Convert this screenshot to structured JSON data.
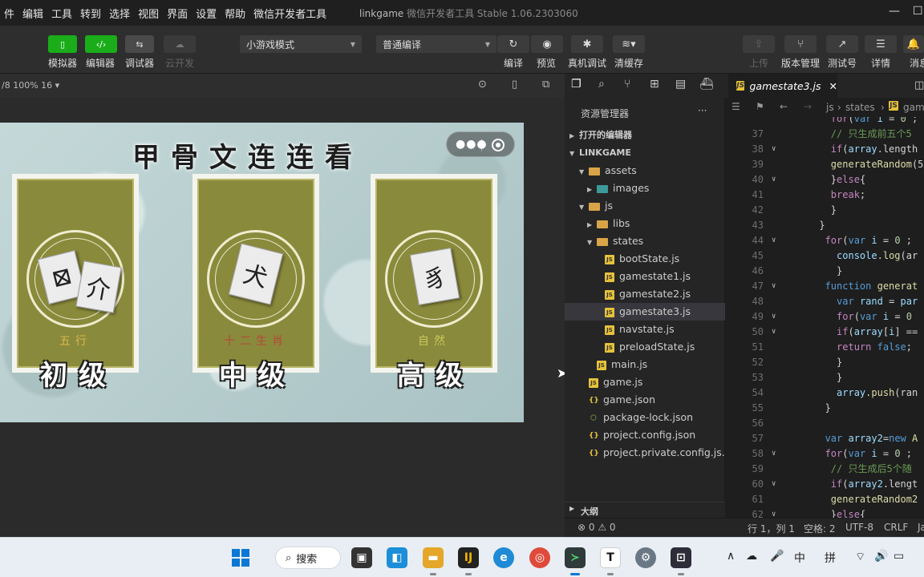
{
  "menu": [
    "件",
    "编辑",
    "工具",
    "转到",
    "选择",
    "视图",
    "界面",
    "设置",
    "帮助",
    "微信开发者工具"
  ],
  "window_title": {
    "project": "linkgame",
    "app": "微信开发者工具 Stable 1.06.2303060"
  },
  "toolbar": {
    "left_buttons": [
      {
        "label": "模拟器",
        "color": "#1aad19"
      },
      {
        "label": "编辑器",
        "color": "#1aad19"
      },
      {
        "label": "调试器",
        "color": "#4a4a4a"
      },
      {
        "label": "云开发",
        "color": "#3a3a3a"
      }
    ],
    "mode_select": "小游戏模式",
    "compile_select": "普通编译",
    "center_buttons": [
      {
        "label": "编译"
      },
      {
        "label": "预览"
      },
      {
        "label": "真机调试"
      },
      {
        "label": "清缓存"
      }
    ],
    "right_buttons": [
      {
        "label": "上传"
      },
      {
        "label": "版本管理"
      },
      {
        "label": "测试号"
      },
      {
        "label": "详情"
      },
      {
        "label": "消息"
      }
    ]
  },
  "simulator": {
    "header": "/8 100% 16 ▾",
    "game_title": "甲骨文连连看",
    "cards": [
      {
        "level": "初级",
        "subtitle": "五行",
        "subtitle_color": "#d9b94a",
        "glyphs": [
          "⊠",
          "介"
        ]
      },
      {
        "level": "中级",
        "subtitle": "十二生肖",
        "subtitle_color": "#b24a3a",
        "glyphs": [
          "犬"
        ]
      },
      {
        "level": "高级",
        "subtitle": "自然",
        "subtitle_color": "#c8c85a",
        "glyphs": [
          "豸"
        ]
      }
    ]
  },
  "explorer": {
    "title": "资源管理器",
    "more": "···",
    "sections": {
      "open_editors": "打开的编辑器",
      "project": "LINKGAME",
      "outline": "大纲"
    },
    "tree": [
      {
        "name": "assets",
        "type": "folder",
        "depth": 1,
        "open": true
      },
      {
        "name": "images",
        "type": "folder-img",
        "depth": 2,
        "open": false
      },
      {
        "name": "js",
        "type": "folder",
        "depth": 1,
        "open": true
      },
      {
        "name": "libs",
        "type": "folder",
        "depth": 2,
        "open": false
      },
      {
        "name": "states",
        "type": "folder",
        "depth": 2,
        "open": true
      },
      {
        "name": "bootState.js",
        "type": "js",
        "depth": 3
      },
      {
        "name": "gamestate1.js",
        "type": "js",
        "depth": 3
      },
      {
        "name": "gamestate2.js",
        "type": "js",
        "depth": 3
      },
      {
        "name": "gamestate3.js",
        "type": "js",
        "depth": 3,
        "selected": true
      },
      {
        "name": "navstate.js",
        "type": "js",
        "depth": 3
      },
      {
        "name": "preloadState.js",
        "type": "js",
        "depth": 3
      },
      {
        "name": "main.js",
        "type": "js",
        "depth": 2
      },
      {
        "name": "game.js",
        "type": "js",
        "depth": 1
      },
      {
        "name": "game.json",
        "type": "json",
        "depth": 1
      },
      {
        "name": "package-lock.json",
        "type": "pkg",
        "depth": 1
      },
      {
        "name": "project.config.json",
        "type": "json",
        "depth": 1
      },
      {
        "name": "project.private.config.js...",
        "type": "json",
        "depth": 1
      }
    ]
  },
  "editor": {
    "tab": "gamestate3.js",
    "breadcrumb": [
      "js",
      "states",
      "gam"
    ],
    "lines": [
      {
        "n": "",
        "fold": false,
        "html": "        <span class='kw'>for</span>(<span class='kb'>var</span> <span class='vr'>i</span> = <span class='nm'>0</span> ;"
      },
      {
        "n": "37",
        "fold": false,
        "html": "        <span class='cm'>// 只生成前五个5</span>"
      },
      {
        "n": "38",
        "fold": true,
        "html": "        <span class='kw'>if</span>(<span class='vr'>array</span>.length"
      },
      {
        "n": "39",
        "fold": false,
        "html": "        <span class='fn'>generateRandom</span>(5"
      },
      {
        "n": "40",
        "fold": true,
        "html": "        }<span class='kw'>else</span>{"
      },
      {
        "n": "41",
        "fold": false,
        "html": "        <span class='kw'>break</span>;"
      },
      {
        "n": "42",
        "fold": false,
        "html": "        }"
      },
      {
        "n": "43",
        "fold": false,
        "html": "      }"
      },
      {
        "n": "44",
        "fold": true,
        "html": "       <span class='kw'>for</span>(<span class='kb'>var</span> <span class='vr'>i</span> = <span class='nm'>0</span> ;"
      },
      {
        "n": "45",
        "fold": false,
        "html": "         <span class='vr'>console</span>.<span class='fn'>log</span>(ar"
      },
      {
        "n": "46",
        "fold": false,
        "html": "         }"
      },
      {
        "n": "47",
        "fold": true,
        "html": "       <span class='kb'>function</span> <span class='fn'>generat</span>"
      },
      {
        "n": "48",
        "fold": false,
        "html": "         <span class='kb'>var</span> <span class='vr'>rand</span> = <span class='vr'>par</span>"
      },
      {
        "n": "49",
        "fold": true,
        "html": "         <span class='kw'>for</span>(<span class='kb'>var</span> <span class='vr'>i</span> = <span class='nm'>0</span>"
      },
      {
        "n": "50",
        "fold": true,
        "html": "         <span class='kw'>if</span>(<span class='vr'>array</span>[<span class='vr'>i</span>] =="
      },
      {
        "n": "51",
        "fold": false,
        "html": "         <span class='kw'>return</span> <span class='kb'>false</span>;"
      },
      {
        "n": "52",
        "fold": false,
        "html": "         }"
      },
      {
        "n": "53",
        "fold": false,
        "html": "         }"
      },
      {
        "n": "54",
        "fold": false,
        "html": "         <span class='vr'>array</span>.<span class='fn'>push</span>(ran"
      },
      {
        "n": "55",
        "fold": false,
        "html": "       }"
      },
      {
        "n": "56",
        "fold": false,
        "html": ""
      },
      {
        "n": "57",
        "fold": false,
        "html": "       <span class='kb'>var</span> <span class='vr'>array2</span>=<span class='kb'>new</span> <span class='fn'>A</span>"
      },
      {
        "n": "58",
        "fold": true,
        "html": "       <span class='kw'>for</span>(<span class='kb'>var</span> <span class='vr'>i</span> = <span class='nm'>0</span> ;"
      },
      {
        "n": "59",
        "fold": false,
        "html": "        <span class='cm'>// 只生成后5个随</span>"
      },
      {
        "n": "60",
        "fold": true,
        "html": "        <span class='kw'>if</span>(<span class='vr'>array2</span>.lengt"
      },
      {
        "n": "61",
        "fold": false,
        "html": "        <span class='fn'>generateRandom2</span>"
      },
      {
        "n": "62",
        "fold": true,
        "html": "        }<span class='kw'>else</span>{"
      }
    ]
  },
  "status": {
    "problems": "⊗ 0 ⚠ 0",
    "position": "行 1，列 1",
    "spaces": "空格: 2",
    "encoding": "UTF-8",
    "eol": "CRLF",
    "lang": "Ja"
  },
  "taskbar": {
    "search_label": "搜索",
    "ime1": "中",
    "ime2": "拼",
    "t_label": "T"
  }
}
